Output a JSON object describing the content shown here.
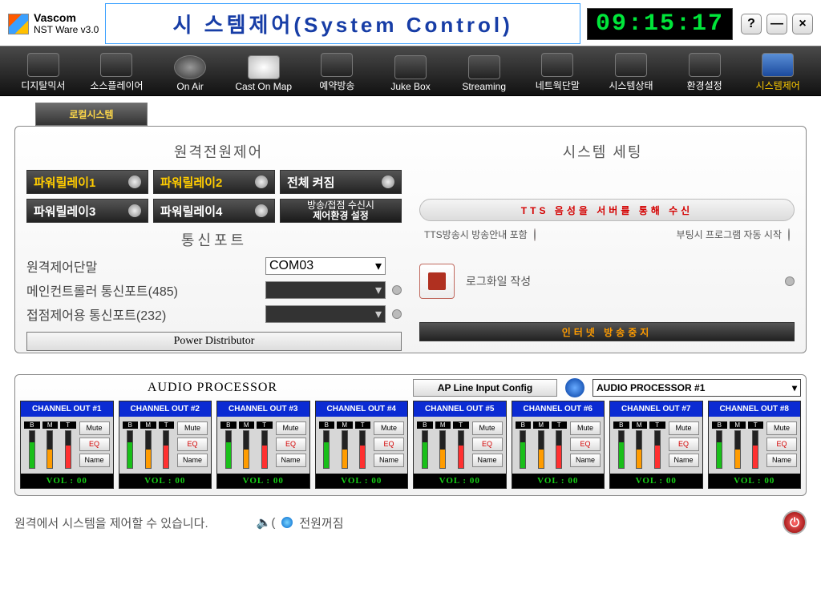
{
  "brand": {
    "name": "Vascom",
    "sub": "NST Ware v3.0"
  },
  "title": "시 스템제어(System  Control)",
  "clock": "09:15:17",
  "winbuttons": {
    "help": "?",
    "min": "—",
    "close": "×"
  },
  "toolbar": [
    {
      "label": "디지탈믹서"
    },
    {
      "label": "소스플레이어"
    },
    {
      "label": "On Air"
    },
    {
      "label": "Cast On Map"
    },
    {
      "label": "예약방송"
    },
    {
      "label": "Juke Box"
    },
    {
      "label": "Streaming"
    },
    {
      "label": "네트웍단말"
    },
    {
      "label": "시스템상태"
    },
    {
      "label": "환경설정"
    },
    {
      "label": "시스템제어",
      "active": true
    }
  ],
  "tab": "로컬시스템",
  "sections": {
    "left": "원격전원제어",
    "right": "시스템 세팅",
    "comm": "통신포트"
  },
  "relays": {
    "r1": "파워릴레이1",
    "r2": "파워릴레이2",
    "r3": "파워릴레이3",
    "r4": "파워릴레이4",
    "all_on": "전체 켜짐",
    "env1": "방송/접점 수신시",
    "env2": "제어환경 설정"
  },
  "ports": {
    "remote_label": "원격제어단말",
    "remote_value": "COM03",
    "main_label": "메인컨트롤러 통신포트(485)",
    "contact_label": "접점제어용  통신포트(232)"
  },
  "power_dist": "Power Distributor",
  "tts": {
    "band": "TTS 음성을 서버를 통해 수신",
    "opt1": "TTS방송시 방송안내 포함",
    "opt2": "부팅시 프로그램 자동 시작"
  },
  "log_label": "로그화일 작성",
  "net_stop": "인터넷 방송중지",
  "ap": {
    "title": "AUDIO PROCESSOR",
    "config": "AP Line Input Config",
    "selected": "AUDIO PROCESSOR #1"
  },
  "channels": [
    {
      "name": "CHANNEL OUT #1",
      "vol": "VOL : 00"
    },
    {
      "name": "CHANNEL OUT #2",
      "vol": "VOL : 00"
    },
    {
      "name": "CHANNEL OUT #3",
      "vol": "VOL : 00"
    },
    {
      "name": "CHANNEL OUT #4",
      "vol": "VOL : 00"
    },
    {
      "name": "CHANNEL OUT #5",
      "vol": "VOL : 00"
    },
    {
      "name": "CHANNEL OUT #6",
      "vol": "VOL : 00"
    },
    {
      "name": "CHANNEL OUT #7",
      "vol": "VOL : 00"
    },
    {
      "name": "CHANNEL OUT #8",
      "vol": "VOL : 00"
    }
  ],
  "ch_btns": {
    "mute": "Mute",
    "eq": "EQ",
    "name": "Name",
    "b": "B",
    "m": "M",
    "t": "T"
  },
  "status": {
    "msg": "원격에서 시스템을 제어할 수 있습니다.",
    "power": "전원꺼짐"
  }
}
